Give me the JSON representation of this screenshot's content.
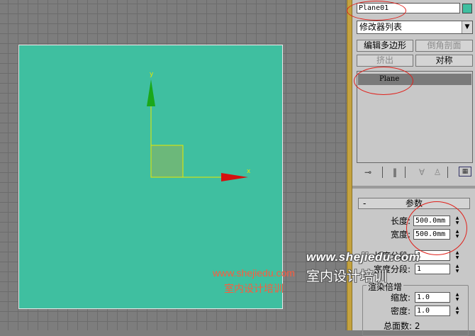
{
  "viewport": {
    "axis_y_label": "y",
    "axis_x_label": "x",
    "watermark_url": "www.shejiedu.com",
    "watermark_cn": "室内设计培训"
  },
  "panel": {
    "object_name": "Plane01",
    "object_color": "#3fbfa0",
    "modifier_list": "修改器列表",
    "buttons": {
      "edit_poly": "编辑多边形",
      "bevel_profile": "倒角剖面",
      "extrude": "挤出",
      "symmetry": "对称"
    },
    "stack_items": [
      "Plane"
    ],
    "tools": [
      "pin-icon",
      "show-end-result-icon",
      "make-unique-icon",
      "remove-modifier-icon",
      "configure-sets-icon"
    ],
    "parameters": {
      "title": "参数",
      "collapse": "-",
      "length_label": "长度:",
      "length_value": "500.0mm",
      "width_label": "宽度:",
      "width_value": "500.0mm",
      "length_segs_label": "长度分段:",
      "length_segs_value": "1",
      "width_segs_label": "宽度分段:",
      "width_segs_value": "1",
      "render_group_label": "渲染倍增",
      "scale_label": "缩放:",
      "scale_value": "1.0",
      "density_label": "密度:",
      "density_value": "1.0",
      "total_faces": "总面数: 2"
    }
  },
  "overlay": {
    "url": "www.shejiedu.com",
    "cn": "室内设计培训"
  },
  "colors": {
    "plane": "#3fbfa0",
    "annotation": "#e0201a",
    "splitter": "#c4a23e"
  }
}
